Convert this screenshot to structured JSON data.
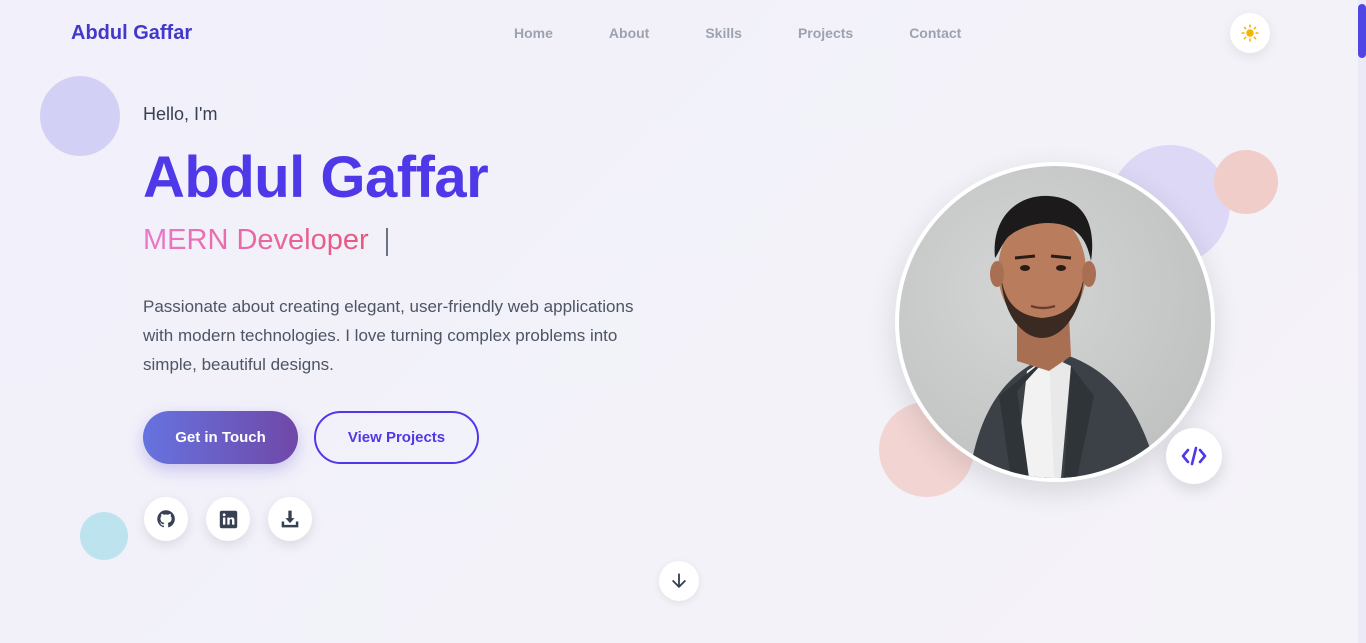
{
  "brand": "Abdul Gaffar",
  "nav": [
    "Home",
    "About",
    "Skills",
    "Projects",
    "Contact"
  ],
  "hero": {
    "greeting": "Hello, I'm",
    "name": "Abdul Gaffar",
    "role": "MERN Developer",
    "description": "Passionate about creating elegant, user-friendly web applications with modern technologies. I love turning complex problems into simple, beautiful designs.",
    "primary_button": "Get in Touch",
    "secondary_button": "View Projects"
  },
  "social": {
    "github_icon": "github-icon",
    "linkedin_icon": "linkedin-icon",
    "download_icon": "download-icon"
  },
  "colors": {
    "accent": "#4f38e8",
    "role_gradient_start": "#e879c9",
    "role_gradient_end": "#e8577a",
    "sun": "#f5b400"
  }
}
